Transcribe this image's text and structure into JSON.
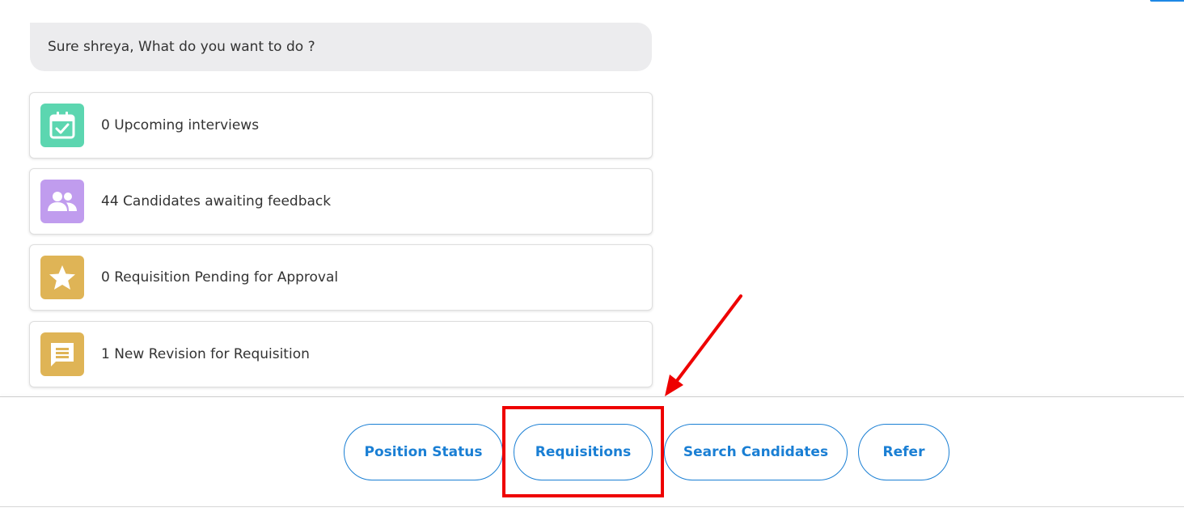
{
  "chat": {
    "message": "Sure shreya, What do you want to do ?"
  },
  "cards": [
    {
      "label": "0 Upcoming interviews",
      "icon": "calendar-check-icon",
      "color": "#5cd6b0"
    },
    {
      "label": "44 Candidates awaiting feedback",
      "icon": "people-icon",
      "color": "#c09cee"
    },
    {
      "label": "0 Requisition Pending for Approval",
      "icon": "star-icon",
      "color": "#dfb456"
    },
    {
      "label": "1 New Revision for Requisition",
      "icon": "message-icon",
      "color": "#dfb456"
    }
  ],
  "quick_actions": {
    "position_status": "Position Status",
    "requisitions": "Requisitions",
    "search_candidates": "Search Candidates",
    "refer": "Refer"
  },
  "colors": {
    "accent": "#1a7fd4",
    "annotation": "#ee0000",
    "bubble": "#ececee"
  }
}
